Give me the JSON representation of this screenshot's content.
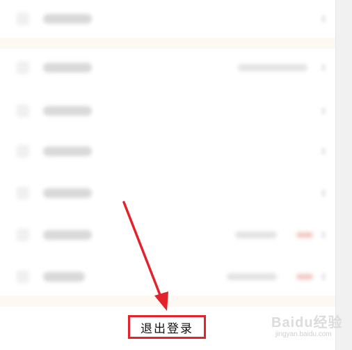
{
  "logout": {
    "label": "退出登录"
  },
  "watermark": {
    "brand": "Baidu经验",
    "url": "jingyan.baidu.com"
  },
  "colors": {
    "highlight_red": "#e3232c",
    "band_cream": "#fdf8f1"
  }
}
